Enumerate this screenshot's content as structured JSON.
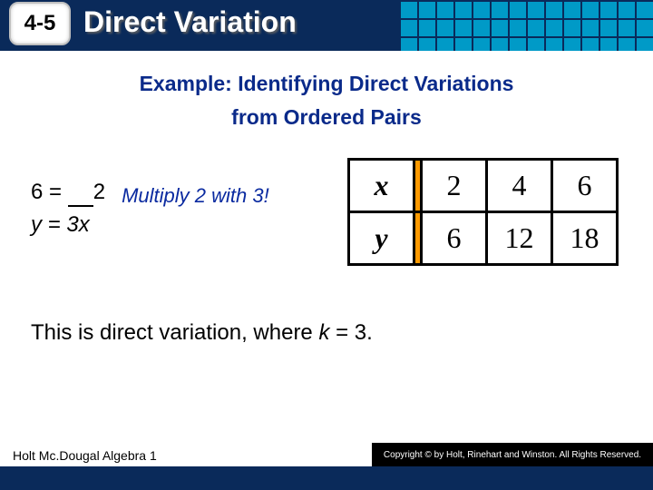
{
  "header": {
    "badge": "4-5",
    "title": "Direct Variation"
  },
  "subtitle_line1": "Example: Identifying Direct Variations",
  "subtitle_line2": "from Ordered Pairs",
  "work": {
    "eq1_lhs": "6 =",
    "eq1_rhs": "2",
    "eq2": "y = 3x",
    "hint": "Multiply 2 with 3!"
  },
  "table": {
    "r1": {
      "hdr": "x",
      "c1": "2",
      "c2": "4",
      "c3": "6"
    },
    "r2": {
      "hdr": "y",
      "c1": "6",
      "c2": "12",
      "c3": "18"
    }
  },
  "conclusion": {
    "pre": "This is direct variation, where ",
    "kvar": "k",
    "post": " = 3."
  },
  "footer": {
    "book": "Holt Mc.Dougal Algebra 1",
    "copyright": "Copyright © by Holt, Rinehart and Winston. All Rights Reserved."
  },
  "chart_data": {
    "type": "table",
    "title": "Ordered pairs for direct variation y = 3x (k = 3)",
    "columns": [
      "x",
      "y"
    ],
    "rows": [
      {
        "x": 2,
        "y": 6
      },
      {
        "x": 4,
        "y": 12
      },
      {
        "x": 6,
        "y": 18
      }
    ],
    "k": 3
  }
}
